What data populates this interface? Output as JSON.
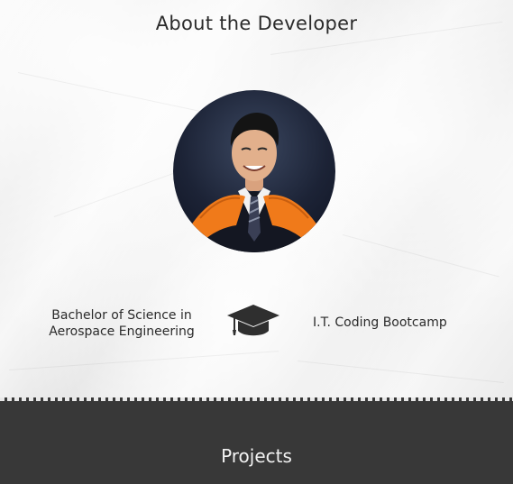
{
  "about": {
    "title": "About the Developer",
    "avatar_alt": "Developer graduation portrait"
  },
  "education": {
    "left_line1": "Bachelor of Science in",
    "left_line2": "Aerospace Engineering",
    "center_icon": "graduation-cap-icon",
    "right": "I.T. Coding Bootcamp"
  },
  "footer": {
    "title": "Projects"
  },
  "colors": {
    "footer_bg": "#383838",
    "sash": "#f07a1a",
    "text": "#2b2b2b"
  }
}
